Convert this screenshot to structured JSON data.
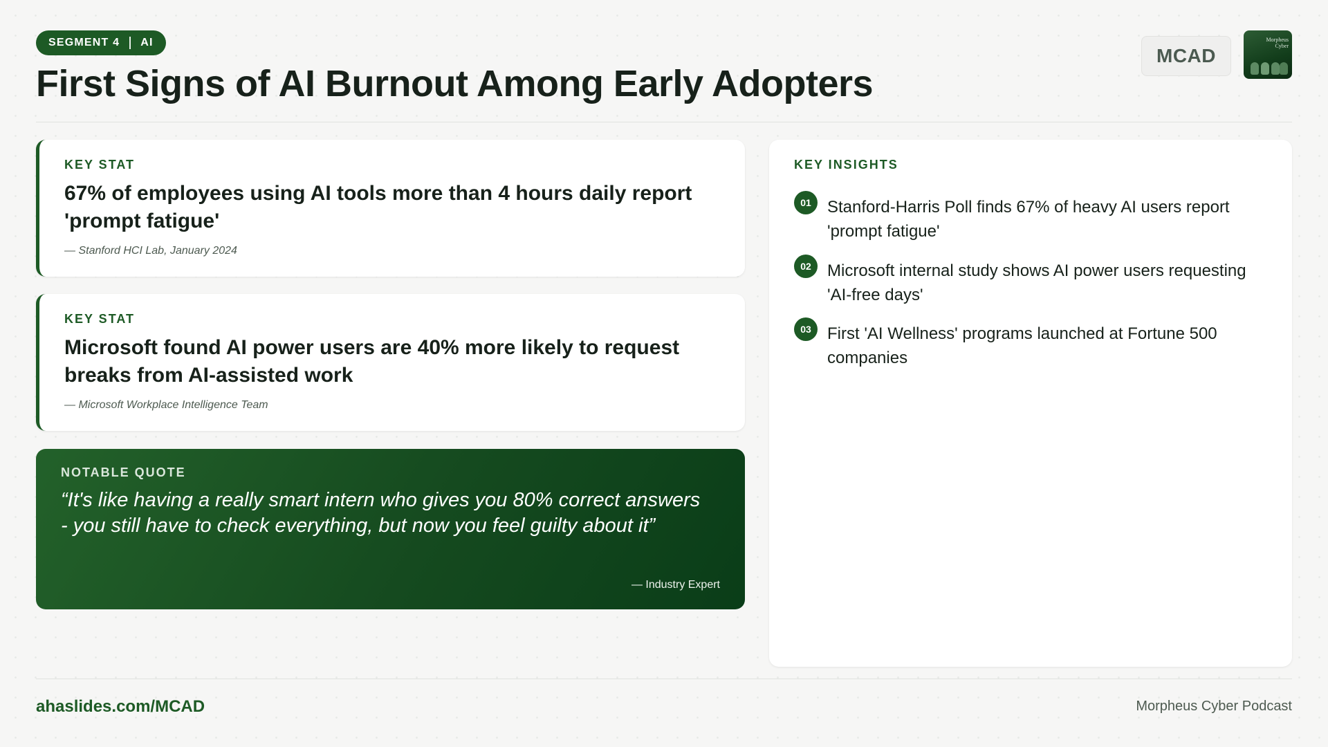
{
  "header": {
    "segment_label": "SEGMENT 4",
    "segment_topic": "AI",
    "title": "First Signs of AI Burnout Among Early Adopters",
    "brand_chip": "MCAD",
    "logo_text": "Morpheus Cyber"
  },
  "stats": [
    {
      "kicker": "KEY STAT",
      "text": "67% of employees using AI tools more than 4 hours daily report 'prompt fatigue'",
      "source": "— Stanford HCI Lab, January 2024"
    },
    {
      "kicker": "KEY STAT",
      "text": "Microsoft found AI power users are 40% more likely to request breaks from AI-assisted work",
      "source": "— Microsoft Workplace Intelligence Team"
    }
  ],
  "quote": {
    "kicker": "NOTABLE QUOTE",
    "text": "“It's like having a really smart intern who gives you 80% correct answers - you still have to check everything, but now you feel guilty about it”",
    "author": "— Industry Expert"
  },
  "insights": {
    "kicker": "KEY INSIGHTS",
    "items": [
      {
        "num": "01",
        "text": "Stanford-Harris Poll finds 67% of heavy AI users report 'prompt fatigue'"
      },
      {
        "num": "02",
        "text": "Microsoft internal study shows AI power users requesting 'AI-free days'"
      },
      {
        "num": "03",
        "text": "First 'AI Wellness' programs launched at Fortune 500 companies"
      }
    ]
  },
  "footer": {
    "link": "ahaslides.com/MCAD",
    "brand": "Morpheus Cyber Podcast"
  },
  "colors": {
    "accent": "#1d5a25",
    "background": "#f6f6f5",
    "text": "#17211a"
  }
}
